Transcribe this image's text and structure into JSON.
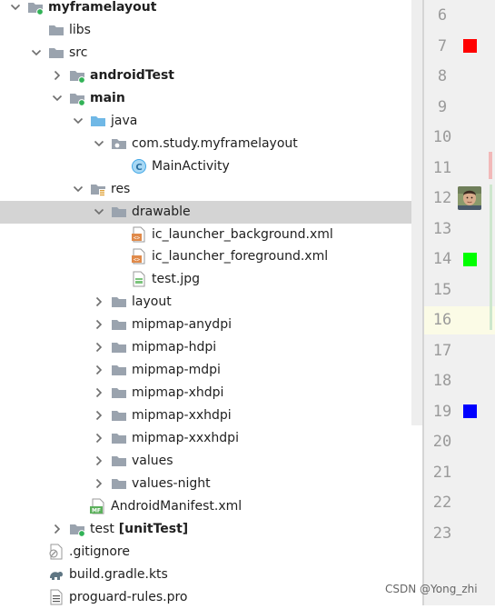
{
  "project_tree": {
    "rows": [
      {
        "label": "myframelayout",
        "icon": "module-folder-icon",
        "bold": true,
        "expanded": true
      },
      {
        "label": "libs",
        "icon": "folder-icon"
      },
      {
        "label": "src",
        "icon": "folder-icon",
        "expanded": true
      },
      {
        "label": "androidTest",
        "icon": "source-set-folder-icon",
        "bold": true,
        "expanded": false
      },
      {
        "label": "main",
        "icon": "source-set-folder-icon",
        "bold": true,
        "expanded": true
      },
      {
        "label": "java",
        "icon": "source-root-folder-icon",
        "expanded": true
      },
      {
        "label": "com.study.myframelayout",
        "icon": "package-icon",
        "expanded": true
      },
      {
        "label": "MainActivity",
        "icon": "kotlin-class-icon"
      },
      {
        "label": "res",
        "icon": "resources-folder-icon",
        "expanded": true
      },
      {
        "label": "drawable",
        "icon": "folder-icon",
        "expanded": true,
        "selected": true
      },
      {
        "label": "ic_launcher_background.xml",
        "icon": "xml-file-icon"
      },
      {
        "label": "ic_launcher_foreground.xml",
        "icon": "xml-file-icon"
      },
      {
        "label": "test.jpg",
        "icon": "image-file-icon"
      },
      {
        "label": "layout",
        "icon": "folder-icon",
        "expanded": false
      },
      {
        "label": "mipmap-anydpi",
        "icon": "folder-icon",
        "expanded": false
      },
      {
        "label": "mipmap-hdpi",
        "icon": "folder-icon",
        "expanded": false
      },
      {
        "label": "mipmap-mdpi",
        "icon": "folder-icon",
        "expanded": false
      },
      {
        "label": "mipmap-xhdpi",
        "icon": "folder-icon",
        "expanded": false
      },
      {
        "label": "mipmap-xxhdpi",
        "icon": "folder-icon",
        "expanded": false
      },
      {
        "label": "mipmap-xxxhdpi",
        "icon": "folder-icon",
        "expanded": false
      },
      {
        "label": "values",
        "icon": "folder-icon",
        "expanded": false
      },
      {
        "label": "values-night",
        "icon": "folder-icon",
        "expanded": false
      },
      {
        "label": "AndroidManifest.xml",
        "icon": "manifest-file-icon"
      },
      {
        "label": "test",
        "label_suffix": " [unitTest]",
        "icon": "source-set-folder-icon",
        "expanded": false
      },
      {
        "label": ".gitignore",
        "icon": "gitignore-file-icon"
      },
      {
        "label": "build.gradle.kts",
        "icon": "gradle-file-icon"
      },
      {
        "label": "proguard-rules.pro",
        "icon": "text-file-icon"
      }
    ]
  },
  "editor_gutter": {
    "line_numbers": [
      "6",
      "7",
      "8",
      "9",
      "10",
      "11",
      "12",
      "13",
      "14",
      "15",
      "16",
      "17",
      "18",
      "19",
      "20",
      "21",
      "22",
      "23"
    ],
    "current_line": "16",
    "color_swatches": [
      {
        "line": "7",
        "color": "#ff0000",
        "name": "red-color-swatch"
      },
      {
        "line": "14",
        "color": "#00ff00",
        "name": "green-color-swatch"
      },
      {
        "line": "19",
        "color": "#0000ff",
        "name": "blue-color-swatch"
      }
    ],
    "image_thumbnail": {
      "line": "12",
      "name": "image-preview-thumbnail"
    }
  },
  "watermark": "CSDN @Yong_zhi",
  "colors": {
    "folder": "#9aa3ae",
    "source_root": "#70b8e6",
    "module_dot": "#32b257",
    "kotlin_class": "#40a7e6",
    "selection": "#d4d4d4"
  }
}
